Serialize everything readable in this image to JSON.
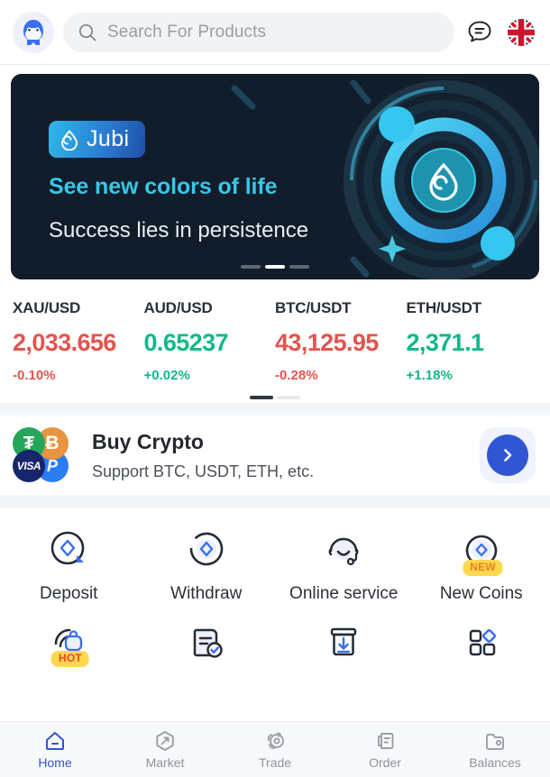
{
  "header": {
    "logo_icon": "penguin-mascot-logo",
    "search": {
      "icon": "search-icon",
      "placeholder": "Search For Products",
      "value": ""
    },
    "chat_icon": "chat-bubble-icon",
    "language_flag": "uk-flag-icon"
  },
  "banner": {
    "brand_icon": "jubi-droplet-icon",
    "brand": "Jubi",
    "headline": "See new colors of life",
    "subhead": "Success lies in persistence",
    "slides_total": 3,
    "active_slide": 2,
    "bg_color": "#121d2b",
    "accent_color": "#37c7e8"
  },
  "tickers": {
    "items": [
      {
        "pair": "XAU/USD",
        "price": "2,033.656",
        "change": "-0.10%",
        "direction": "down"
      },
      {
        "pair": "AUD/USD",
        "price": "0.65237",
        "change": "+0.02%",
        "direction": "up"
      },
      {
        "pair": "BTC/USDT",
        "price": "43,125.95",
        "change": "-0.28%",
        "direction": "down"
      },
      {
        "pair": "ETH/USDT",
        "price": "2,371.1",
        "change": "+1.18%",
        "direction": "up"
      }
    ],
    "pages_total": 2,
    "active_page": 1,
    "up_color": "#11b88a",
    "down_color": "#e2544f"
  },
  "buy_crypto": {
    "title": "Buy Crypto",
    "subtitle": "Support BTC, USDT, ETH, etc.",
    "payment_icons": [
      "usdt-icon",
      "bitcoin-icon",
      "visa-icon",
      "paypal-icon"
    ],
    "usdt_glyph": "₮",
    "btc_glyph": "Ƀ",
    "visa_glyph": "VISA",
    "paypal_glyph": "P",
    "arrow_icon": "chevron-right-icon",
    "arrow_color": "#3056d3"
  },
  "quick_actions": {
    "row1": [
      {
        "label": "Deposit",
        "icon": "deposit-icon",
        "badge": ""
      },
      {
        "label": "Withdraw",
        "icon": "withdraw-icon",
        "badge": ""
      },
      {
        "label": "Online service",
        "icon": "headset-icon",
        "badge": ""
      },
      {
        "label": "New Coins",
        "icon": "new-coins-icon",
        "badge": "NEW"
      }
    ],
    "row2": [
      {
        "label": "",
        "icon": "savings-icon",
        "badge": "HOT"
      },
      {
        "label": "",
        "icon": "verified-doc-icon",
        "badge": ""
      },
      {
        "label": "",
        "icon": "download-box-icon",
        "badge": ""
      },
      {
        "label": "",
        "icon": "more-apps-icon",
        "badge": ""
      }
    ]
  },
  "bottom_nav": {
    "active_color": "#3056d3",
    "items": [
      {
        "label": "Home",
        "icon": "home-icon",
        "active": true
      },
      {
        "label": "Market",
        "icon": "market-icon",
        "active": false
      },
      {
        "label": "Trade",
        "icon": "trade-icon",
        "active": false
      },
      {
        "label": "Order",
        "icon": "order-icon",
        "active": false
      },
      {
        "label": "Balances",
        "icon": "balances-icon",
        "active": false
      }
    ]
  }
}
